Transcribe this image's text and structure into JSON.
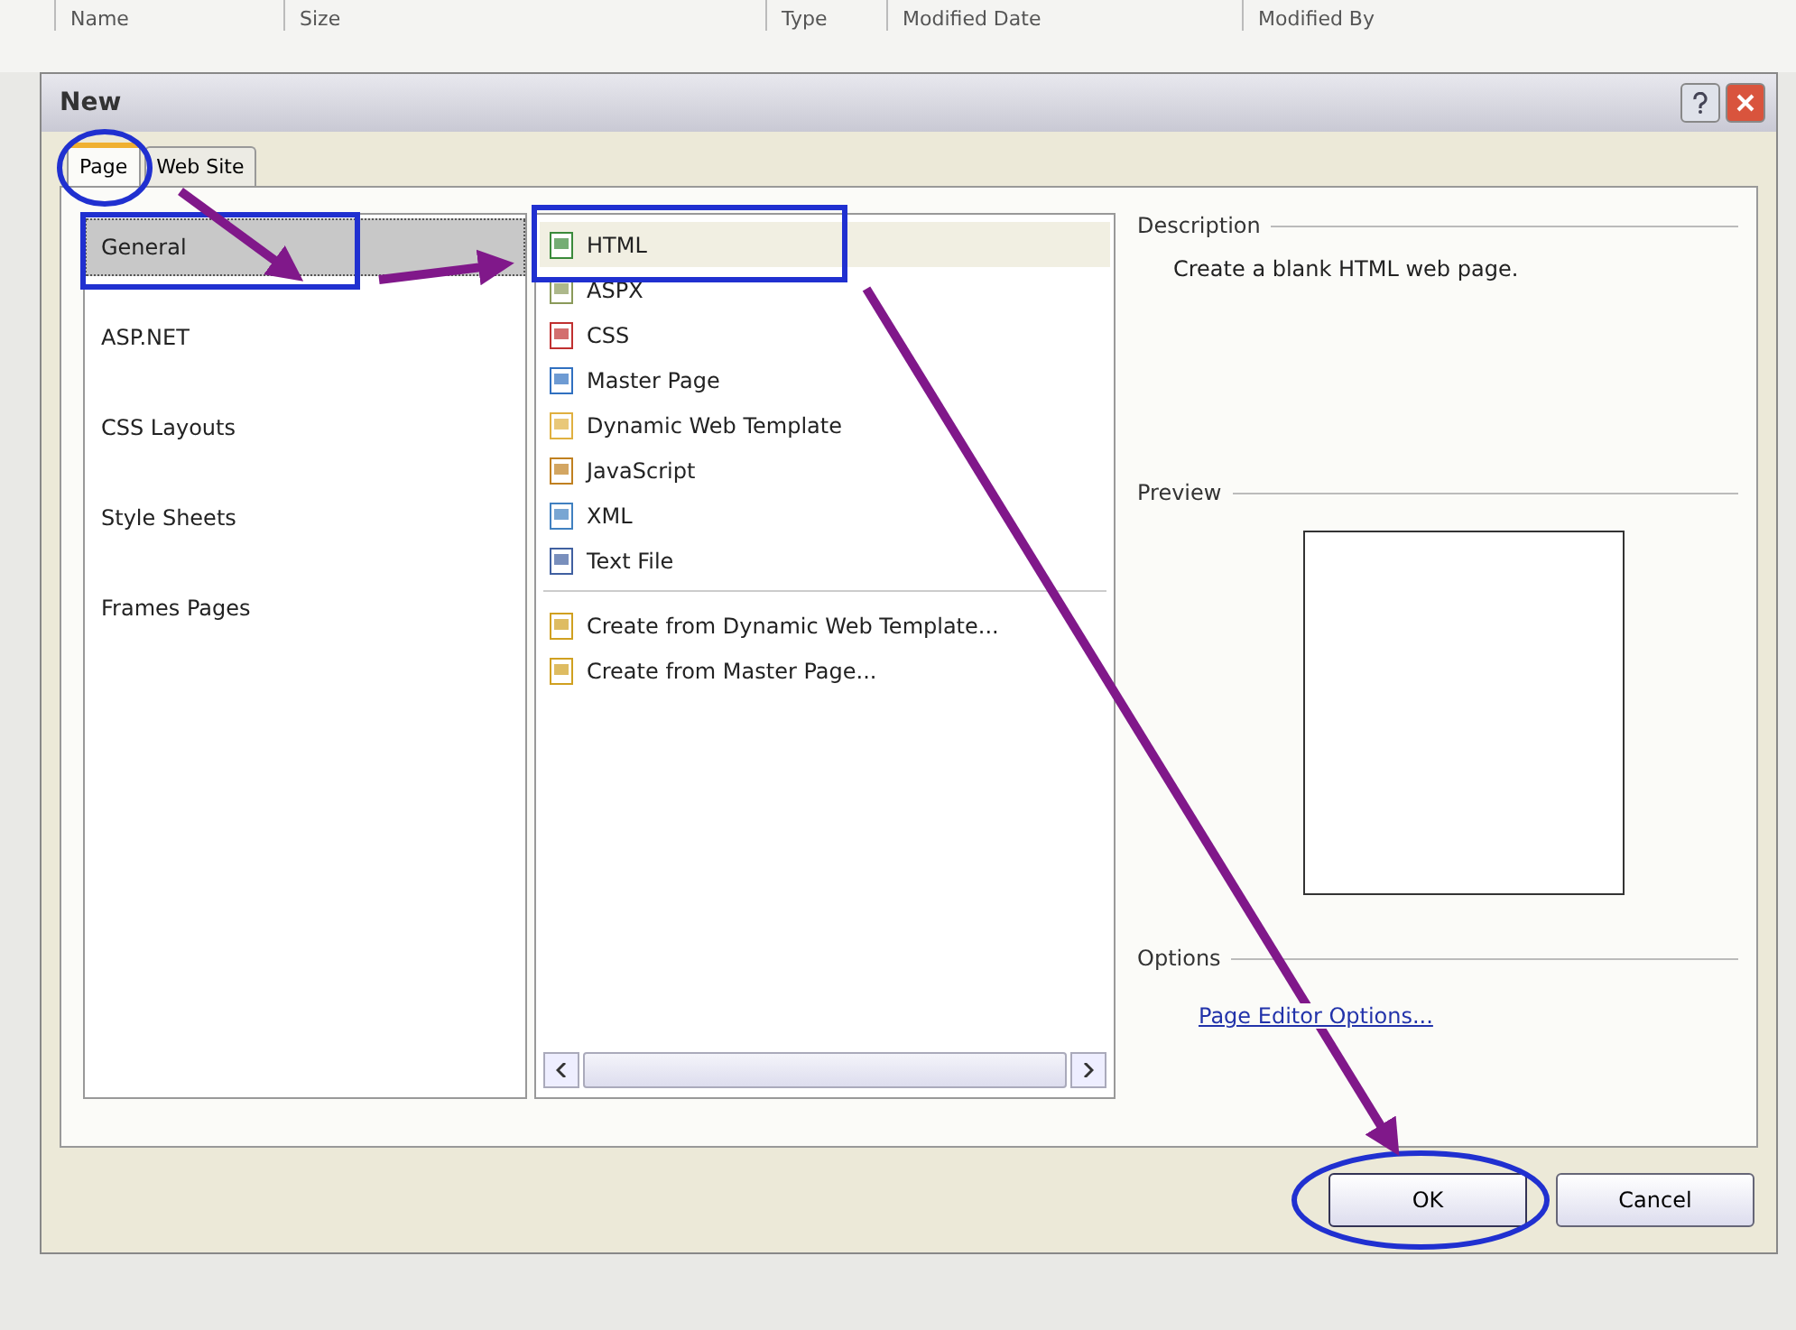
{
  "background_columns": [
    "Name",
    "Size",
    "Type",
    "Modified Date",
    "Modified By"
  ],
  "window": {
    "title": "New"
  },
  "tabs": [
    {
      "label": "Page",
      "selected": true
    },
    {
      "label": "Web Site",
      "selected": false
    }
  ],
  "categories": [
    {
      "label": "General",
      "selected": true
    },
    {
      "label": "ASP.NET",
      "selected": false
    },
    {
      "label": "CSS Layouts",
      "selected": false
    },
    {
      "label": "Style Sheets",
      "selected": false
    },
    {
      "label": "Frames Pages",
      "selected": false
    }
  ],
  "templates": [
    {
      "label": "HTML",
      "kind": "html",
      "selected": true
    },
    {
      "label": "ASPX",
      "kind": "aspx",
      "selected": false
    },
    {
      "label": "CSS",
      "kind": "css",
      "selected": false
    },
    {
      "label": "Master Page",
      "kind": "master",
      "selected": false
    },
    {
      "label": "Dynamic Web Template",
      "kind": "dwt",
      "selected": false
    },
    {
      "label": "JavaScript",
      "kind": "js",
      "selected": false
    },
    {
      "label": "XML",
      "kind": "xml",
      "selected": false
    },
    {
      "label": "Text File",
      "kind": "text",
      "selected": false
    }
  ],
  "create_items": [
    {
      "label": "Create from Dynamic Web Template...",
      "kind": "create"
    },
    {
      "label": "Create from Master Page...",
      "kind": "create"
    }
  ],
  "description": {
    "heading": "Description",
    "text": "Create a blank HTML web page."
  },
  "preview": {
    "heading": "Preview"
  },
  "options": {
    "heading": "Options",
    "link": "Page Editor Options..."
  },
  "buttons": [
    {
      "label": "OK",
      "kind": "default"
    },
    {
      "label": "Cancel",
      "kind": "normal"
    }
  ]
}
